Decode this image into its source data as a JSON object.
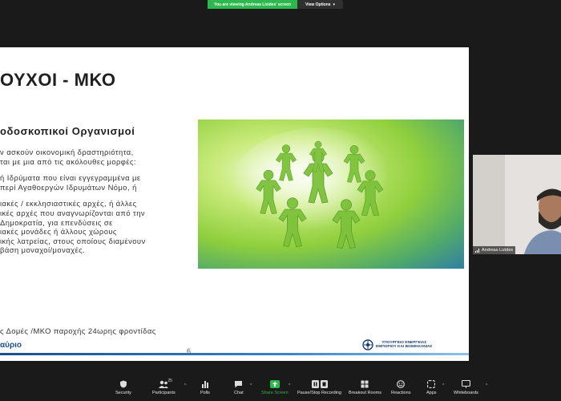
{
  "banner": {
    "viewing_text": "You are viewing Andreas Lizides' screen",
    "view_options_label": "View Options"
  },
  "slide": {
    "title": "ΟΥΧΟΙ - ΜΚΟ",
    "subtitle": "οδοσκοπικοί Οργανισμοί",
    "body_lines": [
      "ν ασκούν οικονομική δραστηριότητα,",
      "ται με μια από τις ακόλουθες μορφές:",
      "",
      "ή Ιδρύματα που είναι εγγεγραμμένα με",
      "περί Αγαθοεργών Ιδρυμάτων Νόμο, ή",
      "",
      "ιακές / εκκλησιαστικές αρχές, ή άλλες",
      "ικές αρχές που αναγνωρίζονται από την",
      " Δημοκρατία, για επενδύσεις σε",
      "ιακές μονάδες ή άλλους χώρους",
      "ικής λατρείας, στους οποίους διαμένουν",
      " βάση μοναχοί/μοναχές."
    ],
    "bottom_line": "ς Δομές /ΜΚΟ παροχής 24ωρης φροντίδας",
    "footer_left": "αύριο",
    "page_number": "6",
    "ministry_line1": "ΥΠΟΥΡΓΕΙΟ ΕΝΕΡΓΕΙΑΣ",
    "ministry_line2": "ΕΜΠΟΡΙΟΥ ΚΑΙ ΒΙΟΜΗΧΑΝΙΑΣ"
  },
  "participant": {
    "name": "Andreas Lizides"
  },
  "toolbar": {
    "security": "Security",
    "participants": "Participants",
    "participants_count": "25",
    "polls": "Polls",
    "chat": "Chat",
    "share_screen": "Share Screen",
    "pause_recording": "Pause/Stop Recording",
    "breakout_rooms": "Breakout Rooms",
    "reactions": "Reactions",
    "apps": "Apps",
    "whiteboards": "Whiteboards"
  },
  "colors": {
    "share_green": "#2db84d",
    "background": "#1a1a1a",
    "brand_blue": "#1b4f8c"
  }
}
